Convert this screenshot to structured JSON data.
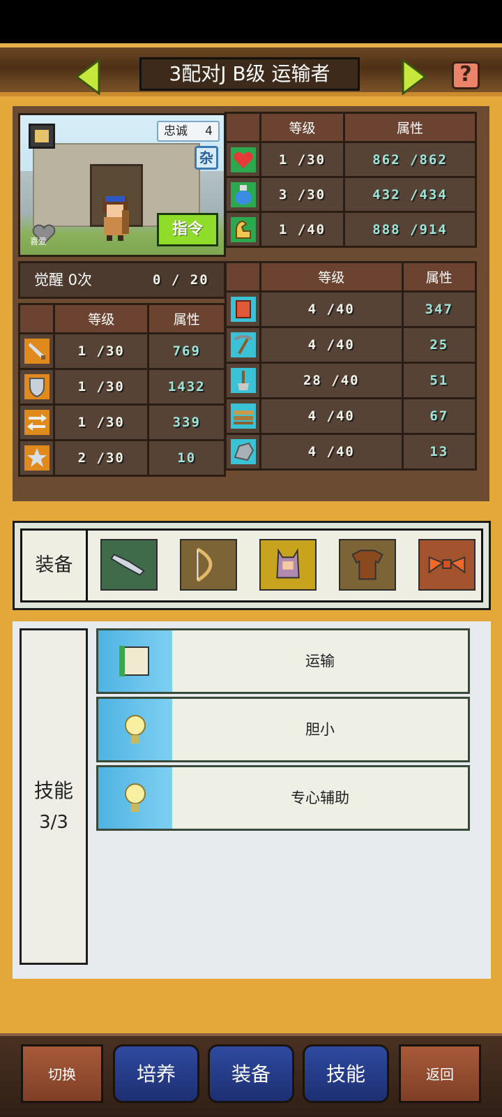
{
  "header": {
    "title": "3配对J B级 运输者",
    "help_label": "?"
  },
  "portrait": {
    "loyalty_label": "忠诚",
    "loyalty_value": "4",
    "tag_label": "杂",
    "favorite_label": "喜爱",
    "command_label": "指令"
  },
  "main_stats": {
    "headers": [
      "等级",
      "属性"
    ],
    "rows": [
      {
        "icon": "heart-icon",
        "level": "1 /30",
        "value": "862 /862"
      },
      {
        "icon": "potion-icon",
        "level": "3 /30",
        "value": "432 /434"
      },
      {
        "icon": "muscle-icon",
        "level": "1 /40",
        "value": "888 /914"
      }
    ]
  },
  "awaken": {
    "label": "觉醒 0次",
    "count": "0 /   20"
  },
  "combat_stats": {
    "headers": [
      "等级",
      "属性"
    ],
    "rows": [
      {
        "icon": "sword-icon",
        "level": "1 /30",
        "value": "769"
      },
      {
        "icon": "shield-icon",
        "level": "1 /30",
        "value": "1432"
      },
      {
        "icon": "arrows-icon",
        "level": "1 /30",
        "value": "339"
      },
      {
        "icon": "star-icon",
        "level": "2 /30",
        "value": "10"
      }
    ]
  },
  "work_stats": {
    "headers": [
      "等级",
      "属性"
    ],
    "rows": [
      {
        "icon": "book-icon",
        "level": "4 /40",
        "value": "347"
      },
      {
        "icon": "pickaxe-icon",
        "level": "4 /40",
        "value": "25"
      },
      {
        "icon": "shovel-icon",
        "level": "28 /40",
        "value": "51"
      },
      {
        "icon": "hay-icon",
        "level": "4 /40",
        "value": "67"
      },
      {
        "icon": "stone-icon",
        "level": "4 /40",
        "value": "13"
      }
    ]
  },
  "equipment": {
    "label": "装备",
    "slots": [
      {
        "icon": "weapon-icon",
        "color": "#3f6b4a"
      },
      {
        "icon": "bow-icon",
        "color": "#7c6437"
      },
      {
        "icon": "cat-costume-icon",
        "color": "#c8a31d"
      },
      {
        "icon": "armor-icon",
        "color": "#7c6437"
      },
      {
        "icon": "ribbon-icon",
        "color": "#a4532f"
      }
    ]
  },
  "skills": {
    "label": "技能",
    "count": "3/3",
    "items": [
      {
        "icon": "scroll-icon",
        "name": "运输"
      },
      {
        "icon": "lightbulb-icon",
        "name": "胆小"
      },
      {
        "icon": "lightbulb-icon",
        "name": "专心辅助"
      }
    ]
  },
  "footer": {
    "switch": "切换",
    "train": "培养",
    "equip": "装备",
    "skill": "技能",
    "back": "返回"
  }
}
